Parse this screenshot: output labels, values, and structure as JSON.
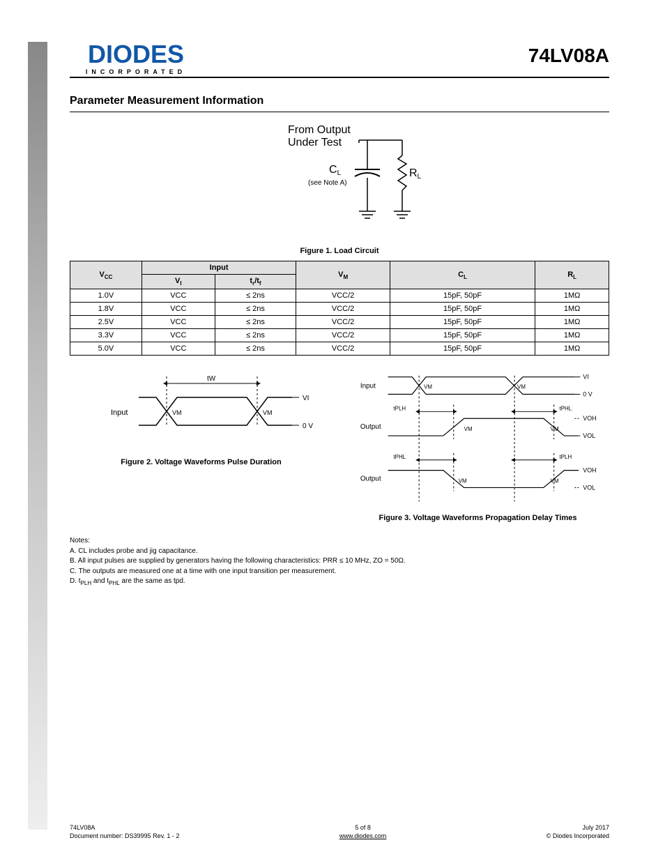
{
  "header": {
    "logo_main": "DIODES",
    "logo_sub": "INCORPORATED",
    "part": "74LV08A"
  },
  "section_title": "Parameter Measurement Information",
  "fig1_caption": "Figure 1. Load Circuit",
  "fig_load_labels": {
    "from_output": "From Output",
    "under_test": "Under Test",
    "cl": "C",
    "cl_sub": "L",
    "note": "(see Note A)",
    "rl": "R",
    "rl_sub": "L"
  },
  "table": {
    "headers": {
      "vcc": "V",
      "vcc_sub": "CC",
      "input": "Input",
      "vi": "V",
      "vi_sub": "I",
      "tr_tf": "t",
      "tr_sub": "r",
      "tf_sub": "f",
      "vm": "V",
      "vm_sub": "M",
      "cl": "C",
      "cl_sub": "L",
      "rl": "R",
      "rl_sub": "L"
    },
    "rows": [
      {
        "vcc": "1.0V",
        "vi": "VCC",
        "tr_tf": "≤ 2ns",
        "vm": "VCC/2",
        "cl": "15pF, 50pF",
        "rl": "1MΩ"
      },
      {
        "vcc": "1.8V",
        "vi": "VCC",
        "tr_tf": "≤ 2ns",
        "vm": "VCC/2",
        "cl": "15pF, 50pF",
        "rl": "1MΩ"
      },
      {
        "vcc": "2.5V",
        "vi": "VCC",
        "tr_tf": "≤ 2ns",
        "vm": "VCC/2",
        "cl": "15pF, 50pF",
        "rl": "1MΩ"
      },
      {
        "vcc": "3.3V",
        "vi": "VCC",
        "tr_tf": "≤ 2ns",
        "vm": "VCC/2",
        "cl": "15pF, 50pF",
        "rl": "1MΩ"
      },
      {
        "vcc": "5.0V",
        "vi": "VCC",
        "tr_tf": "≤ 2ns",
        "vm": "VCC/2",
        "cl": "15pF, 50pF",
        "rl": "1MΩ"
      }
    ]
  },
  "fig2_caption": "Figure 2. Voltage Waveforms Pulse Duration",
  "fig3_caption": "Figure 3. Voltage Waveforms Propagation Delay Times",
  "wave_labels": {
    "input": "Input",
    "output": "Output",
    "tw": "tW",
    "vi": "VI",
    "zero": "0 V",
    "vm": "VM",
    "tplh": "tPLH",
    "tphl": "tPHL",
    "voh": "VOH",
    "vol": "VOL"
  },
  "notes": {
    "lead": "Notes:",
    "a": "A. CL includes probe and jig capacitance.",
    "b": "B. All input pulses are supplied by generators having the following characteristics: PRR ≤ 10 MHz, ZO = 50Ω.",
    "c": "C. The outputs are measured one at a time with one input transition per measurement.",
    "d_pre": "D. t",
    "d_sub1": "PLH",
    "d_mid": " and t",
    "d_sub2": "PHL",
    "d_post": " are the same as tpd."
  },
  "footer": {
    "left_l1": "74LV08A",
    "left_l2": "Document number: DS39995 Rev. 1 - 2",
    "mid_l1": "5 of 8",
    "mid_l2": "www.diodes.com",
    "right_l1": "July 2017",
    "right_l2": "© Diodes Incorporated"
  }
}
